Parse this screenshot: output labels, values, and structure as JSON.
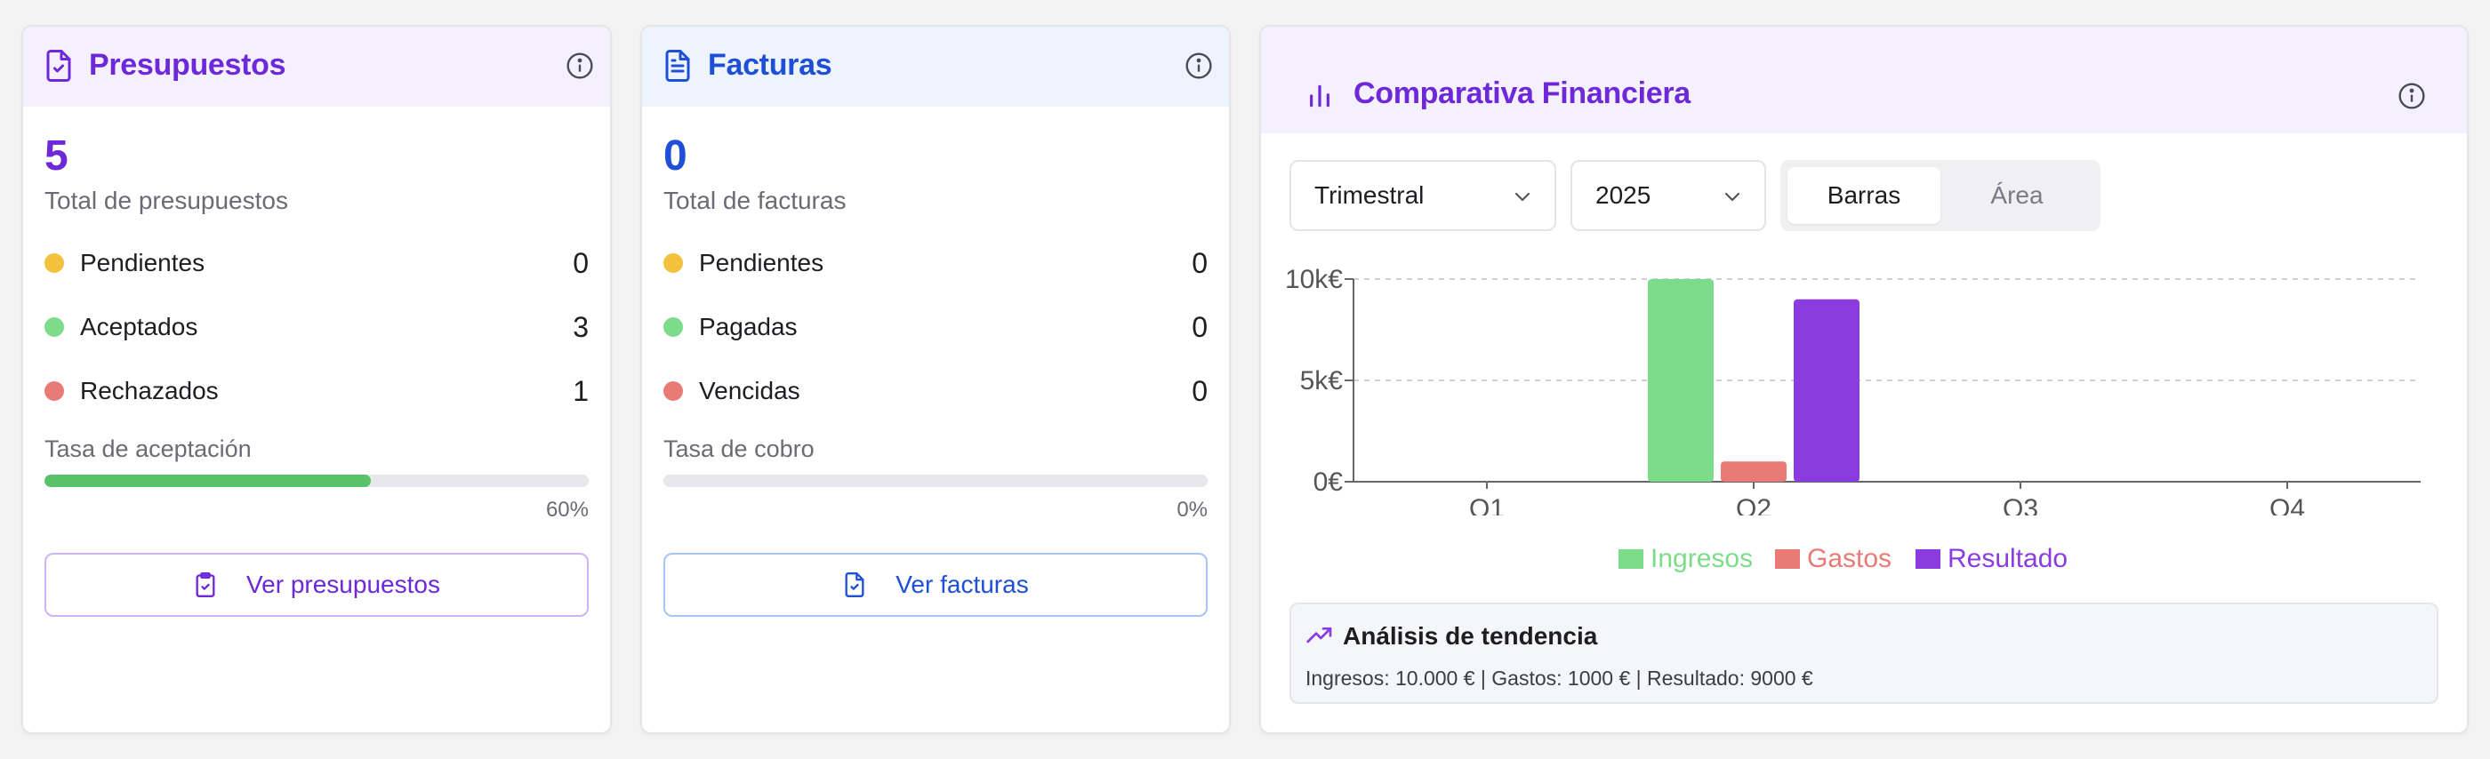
{
  "colors": {
    "purple": "#6d28d9",
    "blue": "#1e4fd6",
    "green": "#7ddc8a",
    "red": "#e97a76",
    "violet": "#8b3ce0",
    "yellow": "#f2c13e"
  },
  "budgets": {
    "title": "Presupuestos",
    "icon": "file-check-icon",
    "total": "5",
    "total_label": "Total de presupuestos",
    "rows": [
      {
        "label": "Pendientes",
        "value": "0",
        "color": "#f2c13e"
      },
      {
        "label": "Aceptados",
        "value": "3",
        "color": "#7ddc8a"
      },
      {
        "label": "Rechazados",
        "value": "1",
        "color": "#e97a76"
      }
    ],
    "rate_label": "Tasa de aceptación",
    "rate_value": 0.6,
    "rate_text": "60%",
    "button_label": "Ver presupuestos"
  },
  "invoices": {
    "title": "Facturas",
    "icon": "file-text-icon",
    "total": "0",
    "total_label": "Total de facturas",
    "rows": [
      {
        "label": "Pendientes",
        "value": "0",
        "color": "#f2c13e"
      },
      {
        "label": "Pagadas",
        "value": "0",
        "color": "#7ddc8a"
      },
      {
        "label": "Vencidas",
        "value": "0",
        "color": "#e97a76"
      }
    ],
    "rate_label": "Tasa de cobro",
    "rate_value": 0,
    "rate_text": "0%",
    "button_label": "Ver facturas"
  },
  "comparison": {
    "title": "Comparativa Financiera",
    "icon": "bar-chart-icon",
    "period_select": "Trimestral",
    "year_select": "2025",
    "view_toggle": [
      "Barras",
      "Área"
    ],
    "active_view": "Barras",
    "trend_title": "Análisis de tendencia",
    "trend_text": "Ingresos: 10.000 € | Gastos: 1000 € | Resultado: 9000 €"
  },
  "chart_data": {
    "type": "bar",
    "categories": [
      "Q1",
      "Q2",
      "Q3",
      "Q4"
    ],
    "series": [
      {
        "name": "Ingresos",
        "values": [
          0,
          10000,
          0,
          0
        ],
        "color": "#7ddc8a"
      },
      {
        "name": "Gastos",
        "values": [
          0,
          1000,
          0,
          0
        ],
        "color": "#e97a76"
      },
      {
        "name": "Resultado",
        "values": [
          0,
          9000,
          0,
          0
        ],
        "color": "#8b3ce0"
      }
    ],
    "yticks": [
      "0€",
      "5k€",
      "10k€"
    ],
    "ylim": [
      0,
      10000
    ],
    "grid": true,
    "legend_position": "bottom"
  }
}
